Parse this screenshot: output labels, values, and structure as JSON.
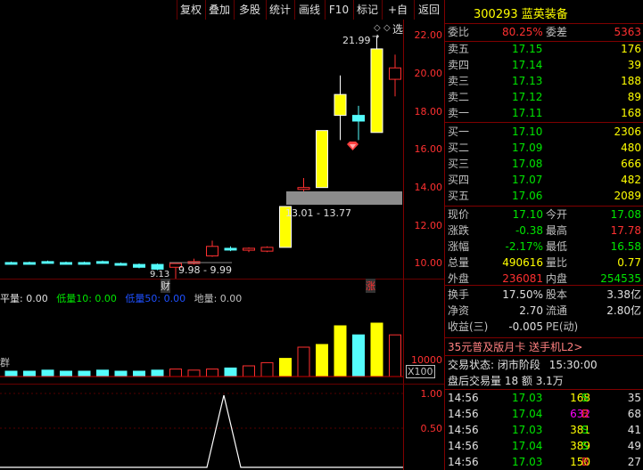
{
  "toolbar": [
    "复权",
    "叠加",
    "多股",
    "统计",
    "画线",
    "F10",
    "标记",
    "+自选",
    "返回"
  ],
  "stock_header": "300293 蓝英装备",
  "price_axis": [
    "22.00",
    "20.00",
    "18.00",
    "16.00",
    "14.00",
    "12.00",
    "10.00"
  ],
  "annotations": {
    "high_label": "21.99",
    "box1": "13.01 - 13.77",
    "box2": "9.98 - 9.99",
    "low_label": "9.13",
    "cai": "财",
    "zhang": "涨"
  },
  "vol_header": {
    "p1": "平量: 0.00",
    "p2": "低量10: 0.00",
    "p3": "低量50: 0.00",
    "p4": "地量: 0.00"
  },
  "vol_axis": {
    "v": "10000",
    "unit": "X100",
    "tag": "群"
  },
  "ind_axis": [
    "1.00",
    "0.50"
  ],
  "weibi": {
    "l1": "委比",
    "v1": "80.25%",
    "l2": "委差",
    "v2": "5363"
  },
  "sells": [
    {
      "label": "卖五",
      "price": "17.15",
      "vol": "176"
    },
    {
      "label": "卖四",
      "price": "17.14",
      "vol": "39"
    },
    {
      "label": "卖三",
      "price": "17.13",
      "vol": "188"
    },
    {
      "label": "卖二",
      "price": "17.12",
      "vol": "89"
    },
    {
      "label": "卖一",
      "price": "17.11",
      "vol": "168"
    }
  ],
  "buys": [
    {
      "label": "买一",
      "price": "17.10",
      "vol": "2306"
    },
    {
      "label": "买二",
      "price": "17.09",
      "vol": "480"
    },
    {
      "label": "买三",
      "price": "17.08",
      "vol": "666"
    },
    {
      "label": "买四",
      "price": "17.07",
      "vol": "482"
    },
    {
      "label": "买五",
      "price": "17.06",
      "vol": "2089"
    }
  ],
  "stats": [
    {
      "l1": "现价",
      "v1": "17.10",
      "c1": "#00e600",
      "l2": "今开",
      "v2": "17.08",
      "c2": "#00e600"
    },
    {
      "l1": "涨跌",
      "v1": "-0.38",
      "c1": "#00e600",
      "l2": "最高",
      "v2": "17.78",
      "c2": "#ff3030"
    },
    {
      "l1": "涨幅",
      "v1": "-2.17%",
      "c1": "#00e600",
      "l2": "最低",
      "v2": "16.58",
      "c2": "#00e600"
    },
    {
      "l1": "总量",
      "v1": "490616",
      "c1": "#ffff00",
      "l2": "量比",
      "v2": "0.77",
      "c2": "#ffff00"
    },
    {
      "l1": "外盘",
      "v1": "236081",
      "c1": "#ff3030",
      "l2": "内盘",
      "v2": "254535",
      "c2": "#00e600"
    }
  ],
  "stats2": [
    {
      "l1": "换手",
      "v1": "17.50%",
      "l2": "股本",
      "v2": "3.38亿"
    },
    {
      "l1": "净资",
      "v1": "2.70",
      "l2": "流通",
      "v2": "2.80亿"
    },
    {
      "l1": "收益(三)",
      "v1": "-0.005",
      "l2": "PE(动)",
      "v2": ""
    }
  ],
  "promo": "35元普及版月卡 送手机L2>",
  "trade_state": {
    "label": "交易状态: 闭市阶段",
    "time": "15:30:00"
  },
  "after_hours": "盘后交易量 18 额 3.1万",
  "ticks": [
    {
      "t": "14:56",
      "p": "17.03",
      "v": "168",
      "vc": "#ffff00",
      "bs": "S",
      "n": "35"
    },
    {
      "t": "14:56",
      "p": "17.04",
      "v": "632",
      "vc": "#ff00ff",
      "bs": "B",
      "n": "68"
    },
    {
      "t": "14:56",
      "p": "17.03",
      "v": "381",
      "vc": "#ffff00",
      "bs": "S",
      "n": "41"
    },
    {
      "t": "14:56",
      "p": "17.04",
      "v": "389",
      "vc": "#ffff00",
      "bs": "S",
      "n": "49"
    },
    {
      "t": "14:56",
      "p": "17.03",
      "v": "150",
      "vc": "#ffff00",
      "bs": "B",
      "n": "27"
    }
  ],
  "chart_data": {
    "type": "candlestick",
    "ylim": [
      9.2,
      22.4
    ],
    "candles": [
      {
        "o": 10.0,
        "c": 10.05,
        "h": 10.1,
        "l": 9.95,
        "up": false
      },
      {
        "o": 10.0,
        "c": 10.05,
        "h": 10.1,
        "l": 9.95,
        "up": false
      },
      {
        "o": 10.05,
        "c": 10.1,
        "h": 10.15,
        "l": 10.0,
        "up": false
      },
      {
        "o": 10.05,
        "c": 10.05,
        "h": 10.1,
        "l": 10.0,
        "up": false
      },
      {
        "o": 10.0,
        "c": 10.05,
        "h": 10.1,
        "l": 9.95,
        "up": false
      },
      {
        "o": 10.05,
        "c": 10.1,
        "h": 10.15,
        "l": 10.0,
        "up": false
      },
      {
        "o": 9.95,
        "c": 10.0,
        "h": 10.05,
        "l": 9.9,
        "up": false
      },
      {
        "o": 9.95,
        "c": 9.8,
        "h": 10.0,
        "l": 9.75,
        "up": false
      },
      {
        "o": 9.95,
        "c": 9.7,
        "h": 10.0,
        "l": 9.65,
        "up": false
      },
      {
        "o": 9.8,
        "c": 10.0,
        "h": 10.05,
        "l": 9.13,
        "up": true
      },
      {
        "o": 10.0,
        "c": 10.1,
        "h": 10.25,
        "l": 9.95,
        "up": true
      },
      {
        "o": 10.4,
        "c": 10.9,
        "h": 11.2,
        "l": 10.35,
        "up": true
      },
      {
        "o": 10.75,
        "c": 10.8,
        "h": 10.9,
        "l": 10.65,
        "up": false
      },
      {
        "o": 10.7,
        "c": 10.8,
        "h": 10.85,
        "l": 10.6,
        "up": true
      },
      {
        "o": 10.65,
        "c": 10.85,
        "h": 10.9,
        "l": 10.6,
        "up": true
      },
      {
        "o": 10.85,
        "c": 13.0,
        "h": 13.0,
        "l": 10.85,
        "up": true,
        "yellow": true
      },
      {
        "o": 13.9,
        "c": 14.0,
        "h": 14.5,
        "l": 13.75,
        "up": true
      },
      {
        "o": 14.0,
        "c": 17.0,
        "h": 17.0,
        "l": 14.0,
        "up": true,
        "yellow": true
      },
      {
        "o": 17.8,
        "c": 18.9,
        "h": 19.9,
        "l": 16.5,
        "up": true,
        "yellow": true
      },
      {
        "o": 17.8,
        "c": 17.5,
        "h": 18.3,
        "l": 16.5,
        "up": false
      },
      {
        "o": 16.9,
        "c": 21.3,
        "h": 21.99,
        "l": 16.9,
        "up": true,
        "yellow": true
      },
      {
        "o": 19.7,
        "c": 20.3,
        "h": 21.0,
        "l": 18.8,
        "up": true
      }
    ],
    "volumes": [
      0.1,
      0.1,
      0.12,
      0.1,
      0.1,
      0.12,
      0.1,
      0.1,
      0.12,
      0.14,
      0.12,
      0.14,
      0.16,
      0.2,
      0.26,
      0.34,
      0.55,
      0.6,
      0.95,
      0.78,
      1.0,
      0.78
    ],
    "vol_max": 12500
  }
}
